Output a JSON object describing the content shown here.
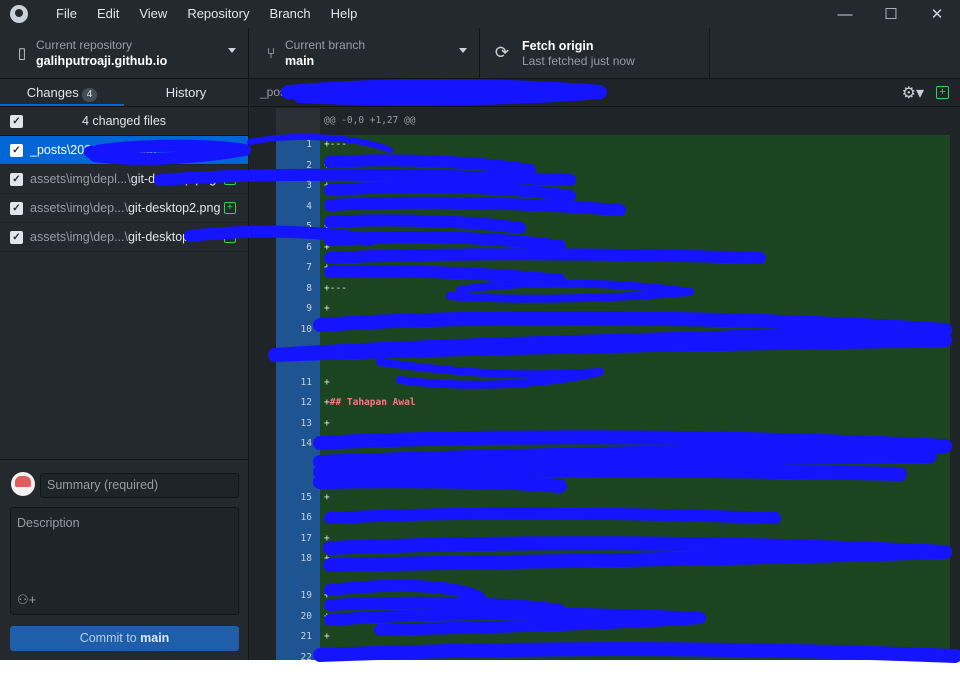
{
  "menu": [
    "File",
    "Edit",
    "View",
    "Repository",
    "Branch",
    "Help"
  ],
  "window_controls": {
    "minimize": "—",
    "maximize": "☐",
    "close": "✕"
  },
  "toolbar": {
    "repo_label": "Current repository",
    "repo_value": "galihputroaji.github.io",
    "branch_label": "Current branch",
    "branch_value": "main",
    "fetch_label": "Fetch origin",
    "fetch_sub": "Last fetched just now"
  },
  "tabs": {
    "changes": "Changes",
    "changes_count": "4",
    "history": "History"
  },
  "files_header": "4 changed files",
  "files": [
    {
      "dir": "_posts\\2022-0",
      "name": "...Github-"
    },
    {
      "dir": "assets\\img\\depl...\\",
      "name": "git-desktop.png"
    },
    {
      "dir": "assets\\img\\dep...\\",
      "name": "git-desktop2.png"
    },
    {
      "dir": "assets\\img\\dep...\\",
      "name": "git-desktop3"
    }
  ],
  "commit": {
    "summary_placeholder": "Summary (required)",
    "description_placeholder": "Description",
    "button_prefix": "Commit to ",
    "button_branch": "main"
  },
  "diff": {
    "filename": "_posts\\... Github-Pages.md",
    "hunk": "@@ -0,0 +1,27 @@",
    "lines": [
      {
        "n": "1",
        "text": "+---"
      },
      {
        "n": "2",
        "text": "+"
      },
      {
        "n": "3",
        "text": "+"
      },
      {
        "n": "4",
        "text": "+"
      },
      {
        "n": "5",
        "text": "+"
      },
      {
        "n": "6",
        "text": "+"
      },
      {
        "n": "7",
        "text": "+"
      },
      {
        "n": "8",
        "text": "+---"
      },
      {
        "n": "9",
        "text": "+"
      },
      {
        "n": "10",
        "text": "+"
      },
      {
        "n": "11",
        "text": "+"
      },
      {
        "n": "12",
        "text": "+## Tahapan Awal"
      },
      {
        "n": "13",
        "text": "+"
      },
      {
        "n": "14",
        "text": "+"
      },
      {
        "n": "15",
        "text": "+"
      },
      {
        "n": "16",
        "text": "+!"
      },
      {
        "n": "17",
        "text": "+"
      },
      {
        "n": "18",
        "text": "+"
      },
      {
        "n": "19",
        "text": "+"
      },
      {
        "n": "20",
        "text": "+"
      },
      {
        "n": "21",
        "text": "+"
      },
      {
        "n": "22",
        "text": "+"
      }
    ]
  }
}
